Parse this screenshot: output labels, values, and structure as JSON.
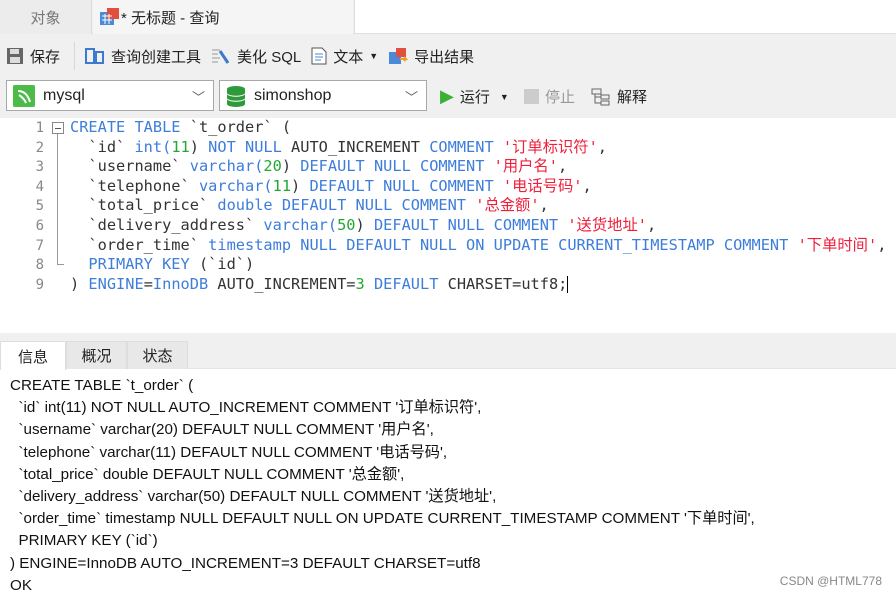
{
  "tabs": {
    "objects": "对象",
    "query": "* 无标题 - 查询"
  },
  "toolbar": {
    "save": "保存",
    "query_builder": "查询创建工具",
    "beautify": "美化 SQL",
    "text": "文本",
    "export": "导出结果"
  },
  "connection": {
    "server": "mysql",
    "database": "simonshop",
    "run": "运行",
    "stop": "停止",
    "explain": "解释"
  },
  "editor": {
    "line_numbers": [
      "1",
      "2",
      "3",
      "4",
      "5",
      "6",
      "7",
      "8",
      "9"
    ],
    "lines": [
      [
        [
          "CREATE TABLE ",
          "kw"
        ],
        [
          "`t_order` (",
          "id"
        ]
      ],
      [
        [
          "  `id` ",
          "id"
        ],
        [
          "int(",
          "kw"
        ],
        [
          "11",
          "num"
        ],
        [
          ") ",
          "id"
        ],
        [
          "NOT NULL ",
          "kw"
        ],
        [
          "AUTO_INCREMENT ",
          "id"
        ],
        [
          "COMMENT ",
          "kw"
        ],
        [
          "'订单标识符'",
          "str"
        ],
        [
          ",",
          "id"
        ]
      ],
      [
        [
          "  `username` ",
          "id"
        ],
        [
          "varchar(",
          "kw"
        ],
        [
          "20",
          "num"
        ],
        [
          ") ",
          "id"
        ],
        [
          "DEFAULT NULL COMMENT ",
          "kw"
        ],
        [
          "'用户名'",
          "str"
        ],
        [
          ",",
          "id"
        ]
      ],
      [
        [
          "  `telephone` ",
          "id"
        ],
        [
          "varchar(",
          "kw"
        ],
        [
          "11",
          "num"
        ],
        [
          ") ",
          "id"
        ],
        [
          "DEFAULT NULL COMMENT ",
          "kw"
        ],
        [
          "'电话号码'",
          "str"
        ],
        [
          ",",
          "id"
        ]
      ],
      [
        [
          "  `total_price` ",
          "id"
        ],
        [
          "double DEFAULT NULL COMMENT ",
          "kw"
        ],
        [
          "'总金额'",
          "str"
        ],
        [
          ",",
          "id"
        ]
      ],
      [
        [
          "  `delivery_address` ",
          "id"
        ],
        [
          "varchar(",
          "kw"
        ],
        [
          "50",
          "num"
        ],
        [
          ") ",
          "id"
        ],
        [
          "DEFAULT NULL COMMENT ",
          "kw"
        ],
        [
          "'送货地址'",
          "str"
        ],
        [
          ",",
          "id"
        ]
      ],
      [
        [
          "  `order_time` ",
          "id"
        ],
        [
          "timestamp NULL DEFAULT NULL ON UPDATE CURRENT_TIMESTAMP COMMENT ",
          "kw"
        ],
        [
          "'下单时间'",
          "str"
        ],
        [
          ",",
          "id"
        ]
      ],
      [
        [
          "  ",
          "id"
        ],
        [
          "PRIMARY KEY ",
          "kw"
        ],
        [
          "(`id`)",
          "id"
        ]
      ],
      [
        [
          ") ",
          "id"
        ],
        [
          "ENGINE",
          "kw"
        ],
        [
          "=",
          "id"
        ],
        [
          "InnoDB ",
          "kw"
        ],
        [
          "AUTO_INCREMENT=",
          "id"
        ],
        [
          "3",
          "num"
        ],
        [
          " DEFAULT ",
          "kw"
        ],
        [
          "CHARSET=utf8;",
          "id"
        ]
      ]
    ]
  },
  "result_tabs": [
    "信息",
    "概况",
    "状态"
  ],
  "info_lines": [
    "CREATE TABLE `t_order` (",
    "  `id` int(11) NOT NULL AUTO_INCREMENT COMMENT '订单标识符',",
    "  `username` varchar(20) DEFAULT NULL COMMENT '用户名',",
    "  `telephone` varchar(11) DEFAULT NULL COMMENT '电话号码',",
    "  `total_price` double DEFAULT NULL COMMENT '总金额',",
    "  `delivery_address` varchar(50) DEFAULT NULL COMMENT '送货地址',",
    "  `order_time` timestamp NULL DEFAULT NULL ON UPDATE CURRENT_TIMESTAMP COMMENT '下单时间',",
    "  PRIMARY KEY (`id`)",
    ") ENGINE=InnoDB AUTO_INCREMENT=3 DEFAULT CHARSET=utf8",
    "OK"
  ],
  "watermark": "CSDN @HTML778",
  "colors": {
    "keyword": "#3d7ddb",
    "string": "#f0203c",
    "number": "#22a832",
    "run_green": "#3cb034"
  }
}
